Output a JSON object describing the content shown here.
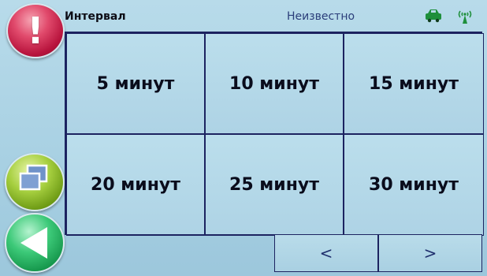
{
  "header": {
    "title": "Интервал",
    "status": "Неизвестно"
  },
  "icons": {
    "alert": "exclamation-icon",
    "windows": "windows-icon",
    "back": "back-arrow-icon",
    "car": "car-icon",
    "signal": "signal-icon",
    "alert_glyph": "!"
  },
  "intervals": [
    "5 минут",
    "10 минут",
    "15 минут",
    "20 минут",
    "25 минут",
    "30 минут"
  ],
  "nav": {
    "prev_label": "<",
    "next_label": ">"
  },
  "colors": {
    "background": "#a9d1e3",
    "grid_line": "#1c2360",
    "accent_green": "#2fbf6f",
    "alert_red": "#c81a44"
  }
}
